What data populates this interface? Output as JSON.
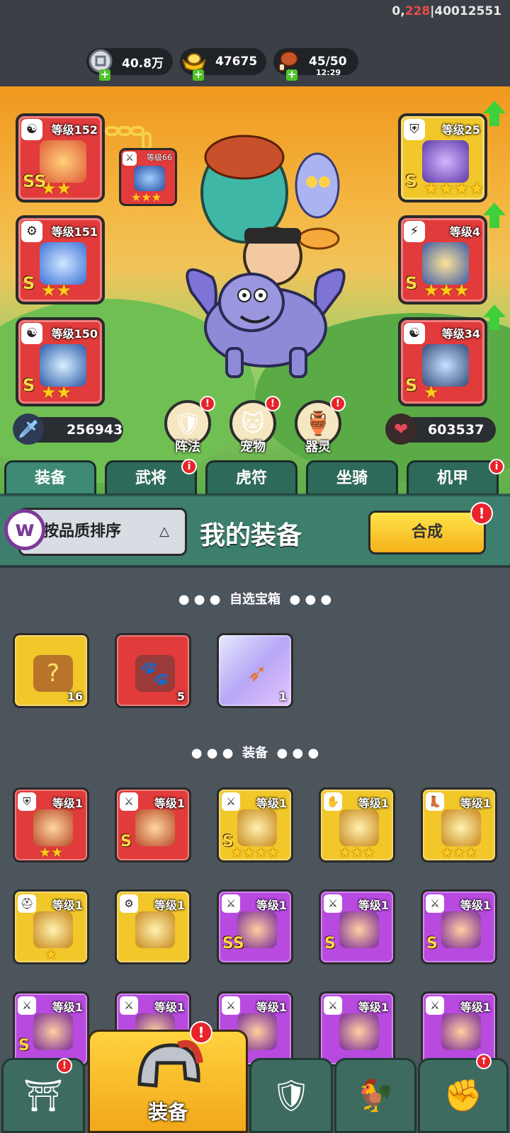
{
  "debug": {
    "prefix": "0,",
    "highlight": "228",
    "suffix": "|40012551"
  },
  "resources": [
    {
      "icon": "silver-coin-icon",
      "value": "40.8万",
      "sub": ""
    },
    {
      "icon": "gold-ingot-icon",
      "value": "47675",
      "sub": ""
    },
    {
      "icon": "meat-stamina-icon",
      "value": "45/50",
      "sub": "12:29"
    }
  ],
  "left_slots": [
    {
      "level": "等级152",
      "grade": "SS",
      "stars": "★★",
      "badge": "☯"
    },
    {
      "level": "等级151",
      "grade": "S",
      "stars": "★★",
      "badge": "⚙"
    },
    {
      "level": "等级150",
      "grade": "S",
      "stars": "★★",
      "badge": "☯"
    }
  ],
  "linked_item": {
    "level": "等级66",
    "stars": "★★★"
  },
  "right_slots": [
    {
      "level": "等级25",
      "grade": "S",
      "stars": "★★★★",
      "badge": "⛨"
    },
    {
      "level": "等级4",
      "grade": "S",
      "stars": "★★★",
      "badge": "⚡"
    },
    {
      "level": "等级34",
      "grade": "S",
      "stars": "★",
      "badge": "☯"
    }
  ],
  "features": [
    {
      "label": "阵法",
      "icon": "formation-icon"
    },
    {
      "label": "宠物",
      "icon": "pet-cat-icon"
    },
    {
      "label": "器灵",
      "icon": "spirit-icon"
    }
  ],
  "stats": {
    "attack": "256943",
    "hp": "603537"
  },
  "tabs": [
    "装备",
    "武将",
    "虎符",
    "坐骑",
    "机甲"
  ],
  "panel": {
    "sort_label": "按品质排序",
    "title": "我的装备",
    "combine_label": "合成"
  },
  "sections": {
    "chests": "自选宝箱",
    "equipment": "装备"
  },
  "chests": [
    {
      "count": "16",
      "color": "yel",
      "icon": "mystery-chest-icon"
    },
    {
      "count": "5",
      "color": "red",
      "icon": "pet-fragment-icon"
    },
    {
      "count": "1",
      "color": "lil",
      "icon": "weapon-fragment-icon"
    }
  ],
  "equipment": [
    {
      "level": "等级1",
      "grade": "",
      "stars": "★★",
      "color": "red",
      "badge": "⛨"
    },
    {
      "level": "等级1",
      "grade": "S",
      "stars": "",
      "color": "red",
      "badge": "⚔"
    },
    {
      "level": "等级1",
      "grade": "S",
      "stars": "★★★★",
      "color": "yel",
      "badge": "⚔"
    },
    {
      "level": "等级1",
      "grade": "",
      "stars": "★★★",
      "color": "yel",
      "badge": "✋"
    },
    {
      "level": "等级1",
      "grade": "",
      "stars": "★★★",
      "color": "yel",
      "badge": "👢"
    },
    {
      "level": "等级1",
      "grade": "",
      "stars": "★",
      "color": "yel",
      "badge": "⛑"
    },
    {
      "level": "等级1",
      "grade": "",
      "stars": "",
      "color": "yel",
      "badge": "⚙"
    },
    {
      "level": "等级1",
      "grade": "SS",
      "stars": "",
      "color": "pur",
      "badge": "⚔"
    },
    {
      "level": "等级1",
      "grade": "S",
      "stars": "",
      "color": "pur",
      "badge": "⚔"
    },
    {
      "level": "等级1",
      "grade": "S",
      "stars": "",
      "color": "pur",
      "badge": "⚔"
    },
    {
      "level": "等级1",
      "grade": "S",
      "stars": "",
      "color": "pur",
      "badge": "⚔"
    },
    {
      "level": "等级1",
      "grade": "",
      "stars": "",
      "color": "pur",
      "badge": "⚔"
    },
    {
      "level": "等级1",
      "grade": "",
      "stars": "",
      "color": "pur",
      "badge": "⚔"
    },
    {
      "level": "等级1",
      "grade": "",
      "stars": "",
      "color": "pur",
      "badge": "⚔"
    },
    {
      "level": "等级1",
      "grade": "",
      "stars": "",
      "color": "pur",
      "badge": "⚔"
    }
  ],
  "bottom_nav": [
    {
      "icon": "shop-gate-icon",
      "label": ""
    },
    {
      "icon": "helmet-icon",
      "label": "装备"
    },
    {
      "icon": "shield-icon",
      "label": ""
    },
    {
      "icon": "rooster-icon",
      "label": ""
    },
    {
      "icon": "fist-upgrade-icon",
      "label": ""
    }
  ],
  "alert": "!",
  "colors": {
    "accent_green": "#3ecf3a",
    "tab_green": "#3d7e6c",
    "alert_red": "#e8232b",
    "button_yellow": "#f4b11a"
  }
}
